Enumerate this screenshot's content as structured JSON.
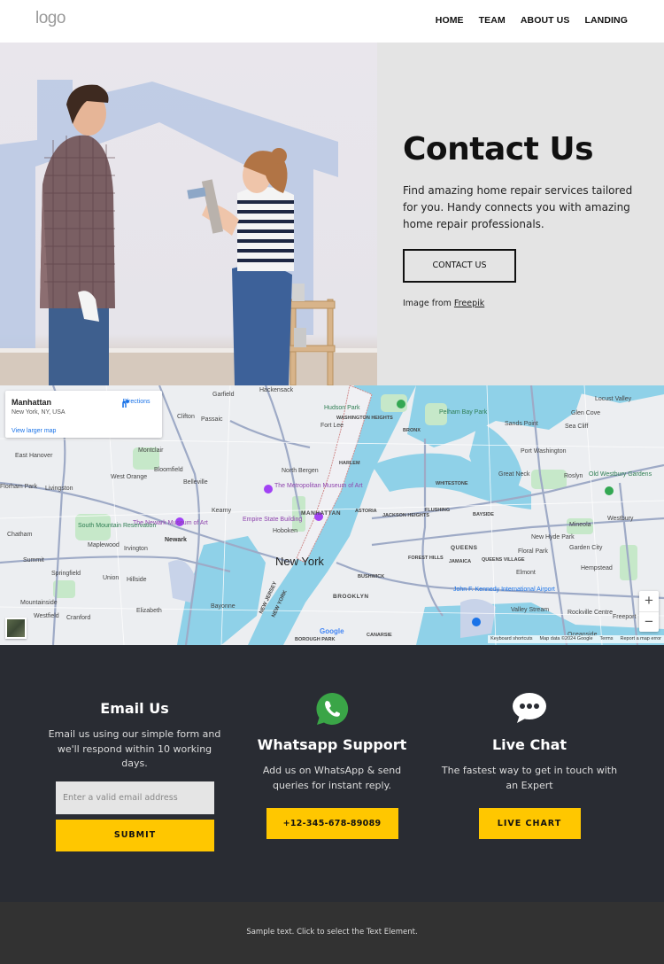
{
  "header": {
    "logo": "logo",
    "nav": [
      {
        "label": "HOME"
      },
      {
        "label": "TEAM"
      },
      {
        "label": "ABOUT US"
      },
      {
        "label": "LANDING"
      }
    ]
  },
  "hero": {
    "title": "Contact Us",
    "description": "Find amazing home repair services tailored for you. Handy connects you with amazing home repair professionals.",
    "button_label": "CONTACT US",
    "credit_prefix": "Image from ",
    "credit_link": "Freepik"
  },
  "map": {
    "place_name": "Manhattan",
    "place_address": "New York, NY, USA",
    "directions_label": "Directions",
    "view_larger_label": "View larger map",
    "zoom_in": "+",
    "zoom_out": "−",
    "google_mark": "Google",
    "attribution": {
      "shortcuts": "Keyboard shortcuts",
      "map_data": "Map data ©2024 Google",
      "terms": "Terms",
      "report": "Report a map error"
    },
    "labels": {
      "new_york": "New York",
      "manhattan": "MANHATTAN",
      "brooklyn": "BROOKLYN",
      "queens": "QUEENS",
      "newark": "Newark",
      "harlem": "HARLEM",
      "bronx": "BRONX",
      "astoria": "ASTORIA",
      "hoboken": "Hoboken",
      "fort_lee": "Fort Lee",
      "hackensack": "Hackensack",
      "clifton": "Clifton",
      "passaic": "Passaic",
      "garfield": "Garfield",
      "montclair": "Montclair",
      "bloomfield": "Bloomfield",
      "belleville": "Belleville",
      "west_orange": "West Orange",
      "east_hanover": "East Hanover",
      "livingston": "Livingston",
      "florham_park": "Florham Park",
      "chatham": "Chatham",
      "summit": "Summit",
      "maplewood": "Maplewood",
      "irvington": "Irvington",
      "springfield": "Springfield",
      "union": "Union",
      "hillside": "Hillside",
      "elizabeth": "Elizabeth",
      "cranford": "Cranford",
      "westfield": "Westfield",
      "mountainside": "Mountainside",
      "bayonne": "Bayonne",
      "kearny": "Kearny",
      "north_bergen": "North Bergen",
      "met_museum": "The Metropolitan Museum of Art",
      "empire_state": "Empire State Building",
      "newark_museum": "The Newark Museum of Art",
      "south_mountain": "South Mountain Reservation",
      "hudson_park": "Hudson Park",
      "pelham_bay": "Pelham Bay Park",
      "sands_point": "Sands Point",
      "port_washington": "Port Washington",
      "great_neck": "Great Neck",
      "glen_cove": "Glen Cove",
      "sea_cliff": "Sea Cliff",
      "locust_valley": "Locust Valley",
      "roslyn": "Roslyn",
      "old_westbury": "Old Westbury Gardens",
      "westbury": "Westbury",
      "mineola": "Mineola",
      "new_hyde_park": "New Hyde Park",
      "garden_city": "Garden City",
      "floral_park": "Floral Park",
      "hempstead": "Hempstead",
      "elmont": "Elmont",
      "valley_stream": "Valley Stream",
      "rockville_centre": "Rockville Centre",
      "freeport": "Freeport",
      "oceanside": "Oceanside",
      "jfk": "John F. Kennedy International Airport",
      "jamaica": "JAMAICA",
      "forest_hills": "FOREST HILLS",
      "bushwick": "BUSHWICK",
      "canarsie": "CANARSIE",
      "borough_park": "BOROUGH PARK",
      "flushing": "FLUSHING",
      "bayside": "BAYSIDE",
      "whitestone": "WHITESTONE",
      "queens_village": "QUEENS VILLAGE",
      "jackson_heights": "JACKSON HEIGHTS",
      "washington_heights": "WASHINGTON HEIGHTS",
      "new_jersey": "NEW JERSEY",
      "new_york_state": "NEW YORK"
    }
  },
  "contact": {
    "email": {
      "title": "Email Us",
      "description": "Email us using our simple form and we'll respond within 10 working days.",
      "placeholder": "Enter a valid email address",
      "button_label": "SUBMIT"
    },
    "whatsapp": {
      "title": "Whatsapp Support",
      "description": "Add us on WhatsApp & send queries for instant reply.",
      "button_label": "+12-345-678-89089",
      "icon_color": "#3aa547"
    },
    "chat": {
      "title": "Live Chat",
      "description": "The fastest way to get in touch with an Expert",
      "button_label": "LIVE CHART"
    },
    "accent_color": "#ffc700",
    "background_color": "#292c33"
  },
  "footer": {
    "text": "Sample text. Click to select the Text Element."
  }
}
